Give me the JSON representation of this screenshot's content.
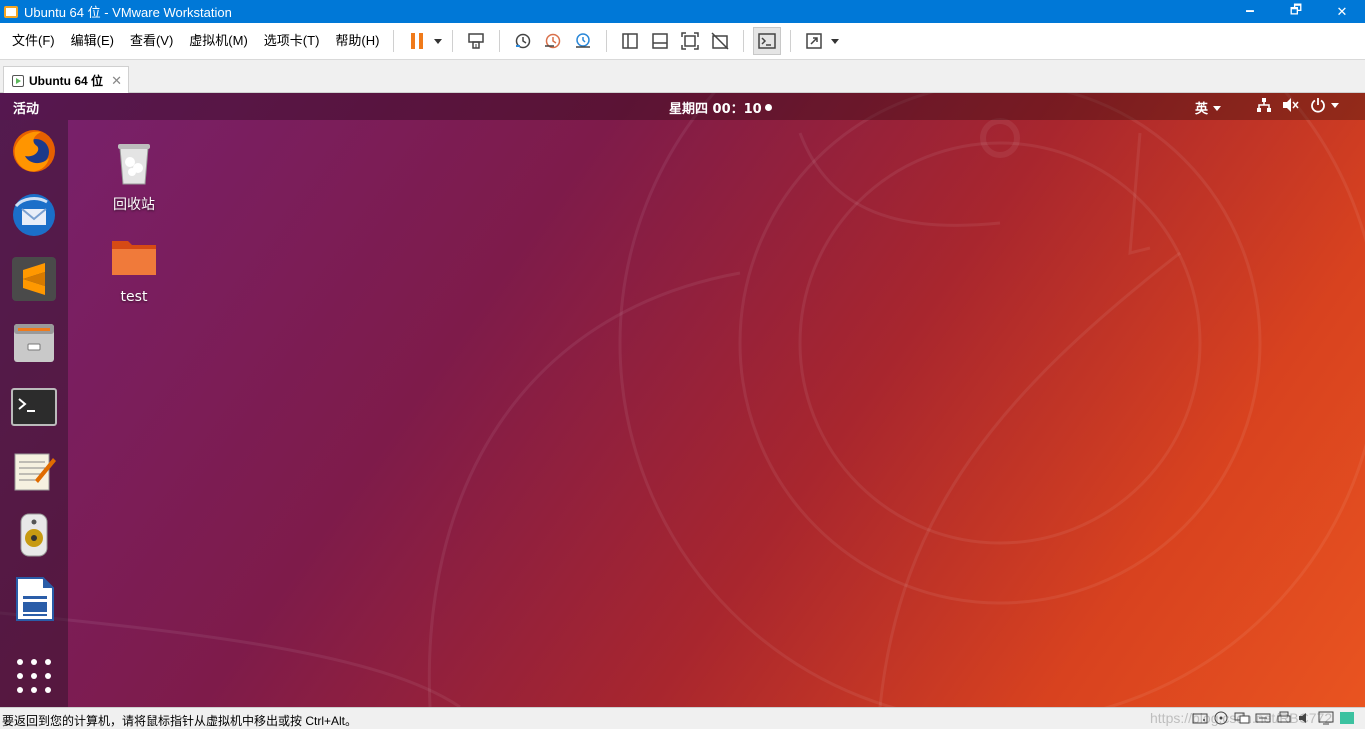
{
  "window": {
    "title": "Ubuntu 64 位 - VMware Workstation",
    "minimize": "🗕",
    "restore": "🗗",
    "close": "✕"
  },
  "menu": [
    "文件(F)",
    "编辑(E)",
    "查看(V)",
    "虚拟机(M)",
    "选项卡(T)",
    "帮助(H)"
  ],
  "toolbar_icons": [
    "pause-icon",
    "send-ctrl-alt-del-icon",
    "snapshot-icon",
    "revert-snapshot-icon",
    "snapshot-manager-icon",
    "show-library-icon",
    "thumbnail-bar-icon",
    "full-screen-icon",
    "unity-icon",
    "console-view-icon",
    "stretch-guest-icon"
  ],
  "tab": {
    "label": "Ubuntu 64 位",
    "close": "✕"
  },
  "guest": {
    "activities": "活动",
    "clock": "星期四 00：10",
    "ime": "英",
    "dock_apps": [
      "firefox-icon",
      "thunderbird-icon",
      "sublime-text-icon",
      "files-icon",
      "terminal-icon",
      "text-editor-icon",
      "rhythmbox-icon",
      "libreoffice-writer-icon"
    ],
    "desktop_icons": [
      {
        "label": "回收站",
        "icon": "trash-icon"
      },
      {
        "label": "test",
        "icon": "folder-icon"
      }
    ]
  },
  "statusbar": {
    "text": "要返回到您的计算机，请将鼠标指针从虚拟机中移出或按 Ctrl+Alt。",
    "watermark": "https://blog.csdn.net/RBC772"
  }
}
